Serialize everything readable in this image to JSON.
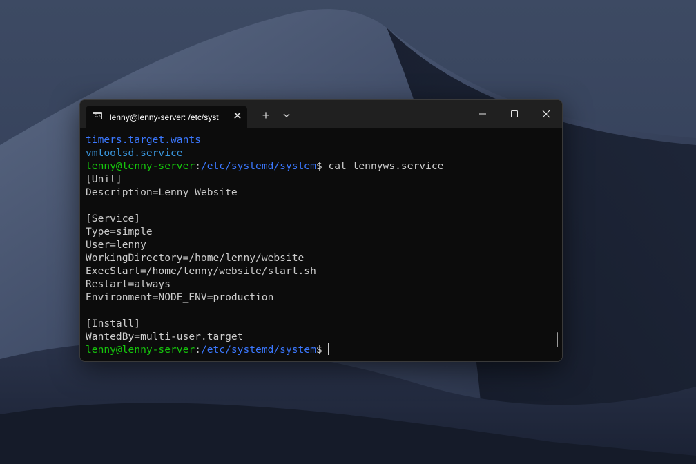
{
  "window": {
    "tab_title": "lenny@lenny-server: /etc/syst",
    "tab_icon_glyph": "C:\\",
    "close_tab_glyph": "✕",
    "new_tab_glyph": "+",
    "icons": [
      "terminal-icon",
      "close-icon",
      "plus-icon",
      "chevron-down-icon",
      "minimize-icon",
      "maximize-icon",
      "close-window-icon"
    ]
  },
  "terminal": {
    "colors": {
      "background": "#0c0c0c",
      "text": "#cccccc",
      "dir_blue": "#3b78ff",
      "user_green": "#16c60c",
      "file_teal": "#3a96dd"
    },
    "lines": [
      {
        "text": "timers.target.wants"
      },
      {
        "text": "vmtoolsd.service"
      },
      {
        "user": "lenny@lenny-server",
        "path": "/etc/systemd/system",
        "command": "cat lennyws.service"
      },
      {
        "text": "[Unit]"
      },
      {
        "text": "Description=Lenny Website"
      },
      {
        "text": ""
      },
      {
        "text": "[Service]"
      },
      {
        "text": "Type=simple"
      },
      {
        "text": "User=lenny"
      },
      {
        "text": "WorkingDirectory=/home/lenny/website"
      },
      {
        "text": "ExecStart=/home/lenny/website/start.sh"
      },
      {
        "text": "Restart=always"
      },
      {
        "text": "Environment=NODE_ENV=production"
      },
      {
        "text": ""
      },
      {
        "text": "[Install]"
      },
      {
        "text": "WantedBy=multi-user.target"
      },
      {
        "user": "lenny@lenny-server",
        "path": "/etc/systemd/system",
        "command": ""
      }
    ]
  }
}
